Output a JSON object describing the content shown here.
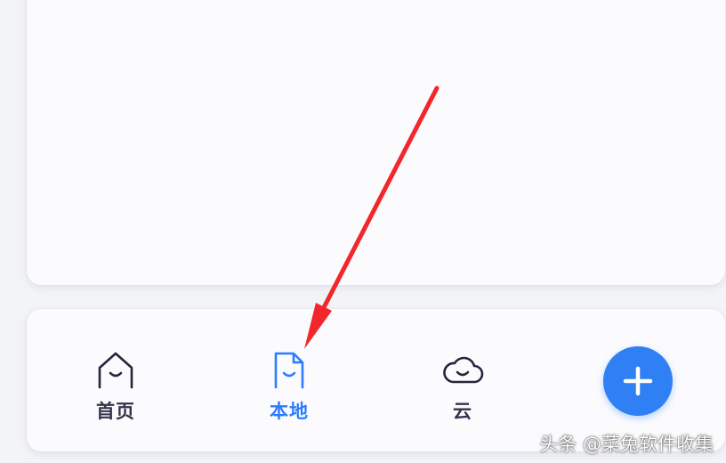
{
  "nav": {
    "items": [
      {
        "label": "首页",
        "icon": "home-icon",
        "active": false
      },
      {
        "label": "本地",
        "icon": "local-file-icon",
        "active": true
      },
      {
        "label": "云",
        "icon": "cloud-icon",
        "active": false
      }
    ],
    "add_icon": "plus-icon"
  },
  "annotation": {
    "arrow_icon": "red-arrow-pointer",
    "arrow_color": "#f2262b"
  },
  "watermark": {
    "text": "头条 @菜兔软件收集"
  },
  "colors": {
    "accent": "#2b7cff",
    "fab": "#2f80f5",
    "inactive_text": "#33334d",
    "background": "#f3f4f8",
    "card": "#fbfbfe"
  }
}
